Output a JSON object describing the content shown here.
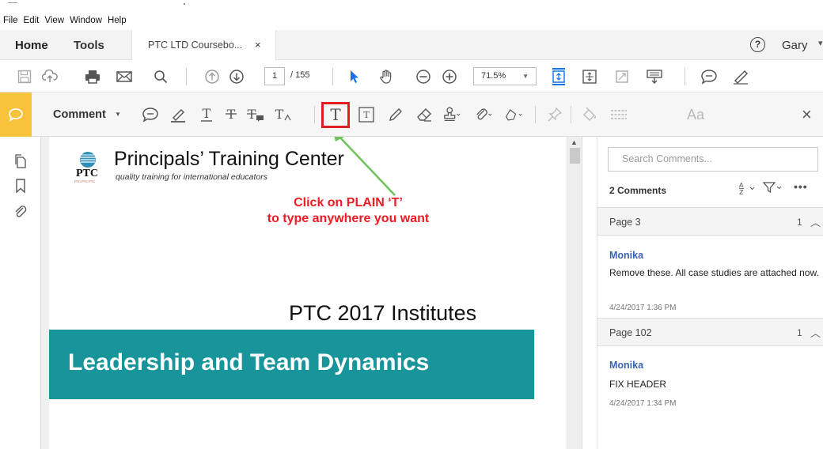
{
  "menu": [
    "File",
    "Edit",
    "View",
    "Window",
    "Help"
  ],
  "tabs": {
    "home": "Home",
    "tools": "Tools",
    "document": "PTC LTD Coursebo...",
    "close": "×"
  },
  "help_symbol": "?",
  "user": "Gary",
  "navigation": {
    "page_current": "1",
    "page_total": "/ 155",
    "zoom": "71.5%"
  },
  "comment_toolbar": {
    "label": "Comment",
    "font_label": "Aa",
    "close": "×"
  },
  "document": {
    "logo_text": "PTC",
    "logo_small": "PTC PTC PTC",
    "title": "Principals’ Training Center",
    "subtitle": "quality training for international educators",
    "note_line1": "Click on PLAIN ‘T’",
    "note_line2": "to type anywhere you  want",
    "institutes": "PTC 2017 Institutes",
    "banner": "Leadership and Team Dynamics"
  },
  "comments_pane": {
    "search_placeholder": "Search Comments...",
    "count": "2 Comments",
    "groups": [
      {
        "page": "Page 3",
        "count": "1",
        "author": "Monika",
        "text": "Remove these. All case studies are attached now.",
        "time": "4/24/2017  1:36 PM"
      },
      {
        "page": "Page 102",
        "count": "1",
        "author": "Monika",
        "text": "FIX HEADER",
        "time": "4/24/2017  1:34 PM"
      }
    ]
  },
  "colors": {
    "comment_accent": "#f7c33a",
    "banner": "#17959a",
    "note_text": "#ee1c24",
    "highlight_box": "#e31b23",
    "arrow": "#6ec35a",
    "author": "#3b63b5",
    "select_tool": "#1473e6"
  }
}
